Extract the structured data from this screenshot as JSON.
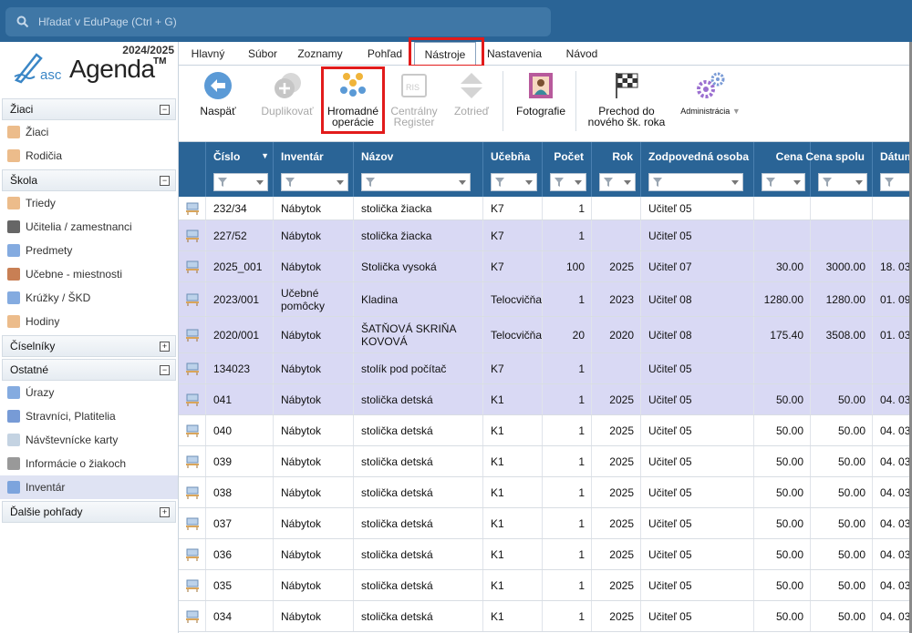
{
  "search": {
    "placeholder": "Hľadať v EduPage (Ctrl + G)"
  },
  "brand": {
    "year": "2024/2025",
    "asc": "asc",
    "agenda": "Agenda",
    "tm": "TM"
  },
  "sidebar": {
    "sections": [
      {
        "label": "Žiaci",
        "toggle": "−",
        "items": [
          {
            "label": "Žiaci",
            "icon": "student-icon"
          },
          {
            "label": "Rodičia",
            "icon": "parents-icon"
          }
        ]
      },
      {
        "label": "Škola",
        "toggle": "−",
        "items": [
          {
            "label": "Triedy",
            "icon": "class-icon"
          },
          {
            "label": "Učitelia / zamestnanci",
            "icon": "teacher-icon"
          },
          {
            "label": "Predmety",
            "icon": "subject-icon"
          },
          {
            "label": "Učebne - miestnosti",
            "icon": "room-icon"
          },
          {
            "label": "Krúžky / ŠKD",
            "icon": "club-icon"
          },
          {
            "label": "Hodiny",
            "icon": "hours-icon"
          }
        ]
      },
      {
        "label": "Číselníky",
        "toggle": "+",
        "items": []
      },
      {
        "label": "Ostatné",
        "toggle": "−",
        "items": [
          {
            "label": "Úrazy",
            "icon": "injury-icon"
          },
          {
            "label": "Stravníci, Platitelia",
            "icon": "diner-icon"
          },
          {
            "label": "Návštevnícke karty",
            "icon": "visitor-card-icon"
          },
          {
            "label": "Informácie o žiakoch",
            "icon": "info-card-icon"
          },
          {
            "label": "Inventár",
            "icon": "inventory-icon",
            "active": true
          }
        ]
      },
      {
        "label": "Ďalšie pohľady",
        "toggle": "+",
        "items": []
      }
    ]
  },
  "menu": {
    "tabs": [
      "Hlavný",
      "Súbor",
      "Zoznamy",
      "Pohľad",
      "Nástroje",
      "Nastavenia",
      "Návod"
    ],
    "selected": "Nástroje"
  },
  "toolbar": {
    "back": "Naspäť",
    "duplicate": "Duplikovať",
    "bulk": [
      "Hromadné",
      "operácie"
    ],
    "register": [
      "Centrálny",
      "Register"
    ],
    "sort": "Zotrieď",
    "photos": "Fotografie",
    "transition": [
      "Prechod do",
      "nového šk. roka"
    ],
    "admin": "Administrácia"
  },
  "table": {
    "columns": [
      "Číslo",
      "Inventár",
      "Názov",
      "Učebňa",
      "Počet",
      "Rok",
      "Zodpovedná osoba",
      "Cena",
      "Cena spolu",
      "Dátum"
    ],
    "rows": [
      {
        "cislo": "232/34",
        "inventar": "Nábytok",
        "nazov": "stolička žiacka",
        "ucebna": "K7",
        "pocet": "1",
        "rok": "",
        "osoba": "Učiteľ 05",
        "cena": "",
        "spolu": "",
        "datum": "",
        "hl": false
      },
      {
        "cislo": "227/52",
        "inventar": "Nábytok",
        "nazov": "stolička žiacka",
        "ucebna": "K7",
        "pocet": "1",
        "rok": "",
        "osoba": "Učiteľ 05",
        "cena": "",
        "spolu": "",
        "datum": "",
        "hl": true
      },
      {
        "cislo": "2025_001",
        "inventar": "Nábytok",
        "nazov": "Stolička vysoká",
        "ucebna": "K7",
        "pocet": "100",
        "rok": "2025",
        "osoba": "Učiteľ 07",
        "cena": "30.00",
        "spolu": "3000.00",
        "datum": "18. 03",
        "hl": true
      },
      {
        "cislo": "2023/001",
        "inventar": "Učebné pomôcky",
        "nazov": "Kladina",
        "ucebna": "Telocvičňa",
        "pocet": "1",
        "rok": "2023",
        "osoba": "Učiteľ 08",
        "cena": "1280.00",
        "spolu": "1280.00",
        "datum": "01. 09",
        "hl": true
      },
      {
        "cislo": "2020/001",
        "inventar": "Nábytok",
        "nazov": "ŠATŇOVÁ SKRIŇA KOVOVÁ",
        "ucebna": "Telocvičňa",
        "pocet": "20",
        "rok": "2020",
        "osoba": "Učiteľ 08",
        "cena": "175.40",
        "spolu": "3508.00",
        "datum": "01. 03",
        "hl": true
      },
      {
        "cislo": "134023",
        "inventar": "Nábytok",
        "nazov": "stolík pod počítač",
        "ucebna": "K7",
        "pocet": "1",
        "rok": "",
        "osoba": "Učiteľ 05",
        "cena": "",
        "spolu": "",
        "datum": "",
        "hl": true
      },
      {
        "cislo": "041",
        "inventar": "Nábytok",
        "nazov": "stolička detská",
        "ucebna": "K1",
        "pocet": "1",
        "rok": "2025",
        "osoba": "Učiteľ 05",
        "cena": "50.00",
        "spolu": "50.00",
        "datum": "04. 03",
        "hl": true
      },
      {
        "cislo": "040",
        "inventar": "Nábytok",
        "nazov": "stolička detská",
        "ucebna": "K1",
        "pocet": "1",
        "rok": "2025",
        "osoba": "Učiteľ 05",
        "cena": "50.00",
        "spolu": "50.00",
        "datum": "04. 03",
        "hl": false
      },
      {
        "cislo": "039",
        "inventar": "Nábytok",
        "nazov": "stolička detská",
        "ucebna": "K1",
        "pocet": "1",
        "rok": "2025",
        "osoba": "Učiteľ 05",
        "cena": "50.00",
        "spolu": "50.00",
        "datum": "04. 03",
        "hl": false
      },
      {
        "cislo": "038",
        "inventar": "Nábytok",
        "nazov": "stolička detská",
        "ucebna": "K1",
        "pocet": "1",
        "rok": "2025",
        "osoba": "Učiteľ 05",
        "cena": "50.00",
        "spolu": "50.00",
        "datum": "04. 03",
        "hl": false
      },
      {
        "cislo": "037",
        "inventar": "Nábytok",
        "nazov": "stolička detská",
        "ucebna": "K1",
        "pocet": "1",
        "rok": "2025",
        "osoba": "Učiteľ 05",
        "cena": "50.00",
        "spolu": "50.00",
        "datum": "04. 03",
        "hl": false
      },
      {
        "cislo": "036",
        "inventar": "Nábytok",
        "nazov": "stolička detská",
        "ucebna": "K1",
        "pocet": "1",
        "rok": "2025",
        "osoba": "Učiteľ 05",
        "cena": "50.00",
        "spolu": "50.00",
        "datum": "04. 03",
        "hl": false
      },
      {
        "cislo": "035",
        "inventar": "Nábytok",
        "nazov": "stolička detská",
        "ucebna": "K1",
        "pocet": "1",
        "rok": "2025",
        "osoba": "Učiteľ 05",
        "cena": "50.00",
        "spolu": "50.00",
        "datum": "04. 03",
        "hl": false
      },
      {
        "cislo": "034",
        "inventar": "Nábytok",
        "nazov": "stolička detská",
        "ucebna": "K1",
        "pocet": "1",
        "rok": "2025",
        "osoba": "Učiteľ 05",
        "cena": "50.00",
        "spolu": "50.00",
        "datum": "04. 03",
        "hl": false
      }
    ]
  },
  "colors": {
    "header_blue": "#2a6496",
    "highlight_row": "#d9d9f4",
    "annotation_red": "#e21b1b"
  }
}
